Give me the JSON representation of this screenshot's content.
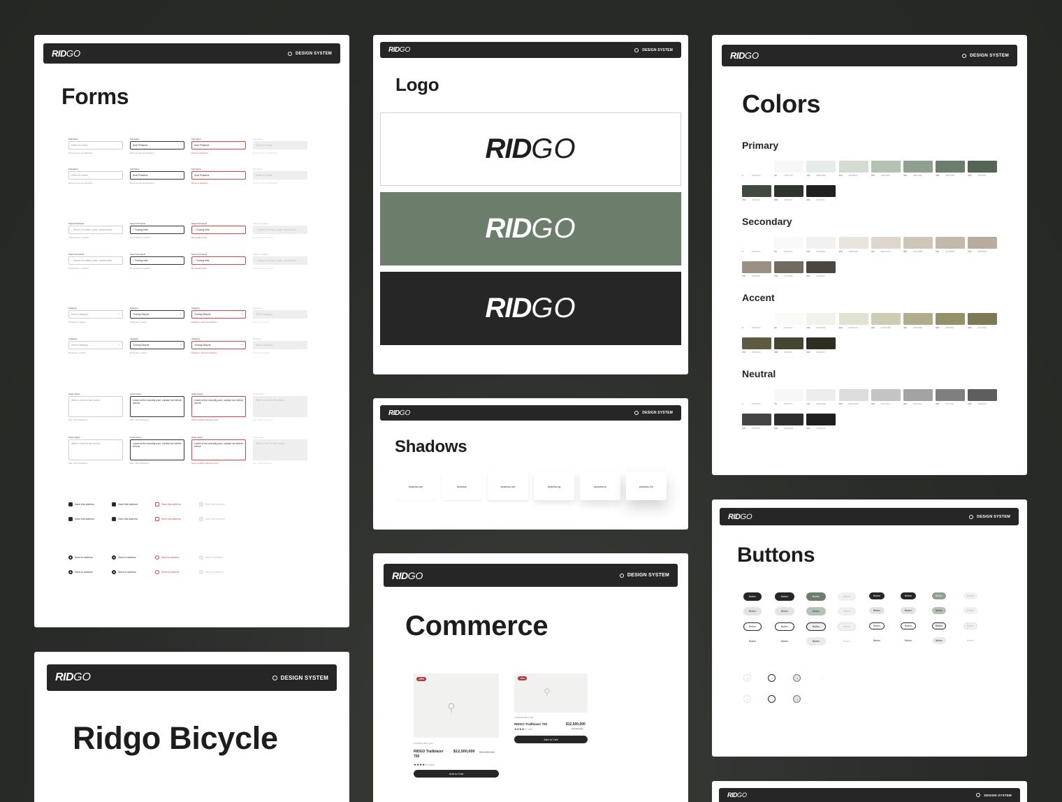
{
  "brand": {
    "logo_main": "RID",
    "logo_go": "GO",
    "header_tag": "DESIGN SYSTEM"
  },
  "forms": {
    "title": "Forms",
    "text_row1": [
      {
        "label": "Full Name",
        "value": "Enter full name",
        "hint": "Name as per identification"
      },
      {
        "label": "Full Name",
        "value": "Andi Pratama",
        "hint": "Name as per identification"
      },
      {
        "label": "Full Name",
        "value": "Andi Pratama",
        "hint": "Name is required"
      },
      {
        "label": "Full Name",
        "value": "Enter full name",
        "hint": "Name as per identification"
      }
    ],
    "text_row2": [
      {
        "label": "Full Name",
        "value": "Enter full name",
        "hint": "Name as per identification"
      },
      {
        "label": "Full Name",
        "value": "Andi Pratama",
        "hint": "Name as per identification"
      },
      {
        "label": "Full Name",
        "value": "Andi Pratama",
        "hint": "Name is required"
      },
      {
        "label": "Full Name",
        "value": "Enter full name",
        "hint": "Name as per identification"
      }
    ],
    "search_row1": [
      {
        "label": "Search Products",
        "value": "Search for bikes, parts, accessories",
        "hint": "Press Enter to search"
      },
      {
        "label": "Search Products",
        "value": "Touring bike",
        "hint": "Press Enter to search"
      },
      {
        "label": "Search Products",
        "value": "Touring bike",
        "hint": "No results found"
      },
      {
        "label": "Search Products",
        "value": "Search for bikes, parts, accessories",
        "hint": "Press Enter to search"
      }
    ],
    "search_row2": [
      {
        "label": "Search Products",
        "value": "Search for bikes, parts, accessories",
        "hint": "Press Enter to search"
      },
      {
        "label": "Search Products",
        "value": "Touring bike",
        "hint": "Press Enter to search"
      },
      {
        "label": "Search Products",
        "value": "Touring bike",
        "hint": "No results found"
      },
      {
        "label": "Search Products",
        "value": "Search for bikes, parts, accessories",
        "hint": "Press Enter to search"
      }
    ],
    "select_row1": [
      {
        "label": "Category",
        "value": "Select category",
        "hint": "Required to select"
      },
      {
        "label": "Category",
        "value": "Touring Bicycle",
        "hint": "Required to select"
      },
      {
        "label": "Category",
        "value": "Touring Bicycle",
        "hint": "Category must be selected"
      },
      {
        "label": "Category",
        "value": "Select category",
        "hint": "Required to select"
      }
    ],
    "select_row2": [
      {
        "label": "Category",
        "value": "Select category",
        "hint": "Required to select"
      },
      {
        "label": "Category",
        "value": "Touring Bicycle",
        "hint": "Required to select"
      },
      {
        "label": "Category",
        "value": "Touring Bicycle",
        "hint": "Category must be selected"
      },
      {
        "label": "Category",
        "value": "Select category",
        "hint": "Required to select"
      }
    ],
    "ta_row1": [
      {
        "label": "Order Notes",
        "value": "Write a note for the courier...",
        "hint": "Max. 200 characters"
      },
      {
        "label": "Order Notes",
        "value": "Leave at the security post, contact me before arrival.",
        "hint": "Max. 200 characters"
      },
      {
        "label": "Order Notes",
        "value": "Leave at the security post, contact me before arrival.",
        "hint": "Note exceeds maximum limit"
      },
      {
        "label": "Order Notes",
        "value": "Write a note for the courier...",
        "hint": "Max. 200 characters"
      }
    ],
    "ta_row2": [
      {
        "label": "Order Notes",
        "value": "Write a note for the courier...",
        "hint": "Max. 200 characters"
      },
      {
        "label": "Order Notes",
        "value": "Leave at the security post, contact me before arrival.",
        "hint": "Max. 200 characters"
      },
      {
        "label": "Order Notes",
        "value": "Leave at the security post, contact me before arrival.",
        "hint": "Note exceeds maximum limit"
      },
      {
        "label": "Order Notes",
        "value": "Write a note for the courier...",
        "hint": "Max. 200 characters"
      }
    ],
    "checkbox_label": "Save this address",
    "radio_label": "Send to address"
  },
  "logo_section": {
    "title": "Logo"
  },
  "shadows": {
    "title": "Shadows",
    "items": [
      "shadow-sm",
      "shadow",
      "shadow-md",
      "shadow-lg",
      "shadow-xl",
      "shadow-2xl"
    ]
  },
  "commerce": {
    "title": "Commerce",
    "card1": {
      "badge": "-20%",
      "category": "TOURING BICYCLE",
      "name": "RIDGO Trailblazer 700",
      "price": "$12,500,000",
      "old_price": "$14,500,000",
      "rating": "(120)",
      "cta": "Add to Cart"
    },
    "card2": {
      "badge": "-20%",
      "category": "TOURING BICYCLE",
      "name": "RIDGO Trailblazer 700",
      "price": "$12,500,000",
      "old_price": "$14,500,000",
      "rating": "(120)",
      "cta": "Add to Cart"
    }
  },
  "colors": {
    "title": "Colors",
    "groups": [
      {
        "name": "Primary",
        "swatches": [
          {
            "step": "0",
            "hex": "#FFFFFF"
          },
          {
            "step": "50",
            "hex": "#F6F7F6"
          },
          {
            "step": "100",
            "hex": "#E8ECE8"
          },
          {
            "step": "200",
            "hex": "#D3DBD3"
          },
          {
            "step": "300",
            "hex": "#B4C2B4"
          },
          {
            "step": "400",
            "hex": "#8EA18E"
          },
          {
            "step": "500",
            "hex": "#6B7D6B"
          },
          {
            "step": "600",
            "hex": "#546554"
          },
          {
            "step": "700",
            "hex": "#414A41"
          },
          {
            "step": "800",
            "hex": "#2E332E"
          },
          {
            "step": "900",
            "hex": "#1E211E"
          }
        ]
      },
      {
        "name": "Secondary",
        "swatches": [
          {
            "step": "0",
            "hex": "#FFFFFF"
          },
          {
            "step": "50",
            "hex": "#FAF9F7"
          },
          {
            "step": "100",
            "hex": "#F3F1ED"
          },
          {
            "step": "200",
            "hex": "#E9E5DE"
          },
          {
            "step": "300",
            "hex": "#DCD6CC"
          },
          {
            "step": "400",
            "hex": "#CEC6B9"
          },
          {
            "step": "500",
            "hex": "#C2B9AB"
          },
          {
            "step": "600",
            "hex": "#B8AD9D"
          },
          {
            "step": "700",
            "hex": "#9A9083"
          },
          {
            "step": "800",
            "hex": "#716A60"
          },
          {
            "step": "900",
            "hex": "#4A4640"
          }
        ]
      },
      {
        "name": "Accent",
        "swatches": [
          {
            "step": "0",
            "hex": "#FFFFFF"
          },
          {
            "step": "50",
            "hex": "#FAFAF7"
          },
          {
            "step": "100",
            "hex": "#F2F2EB"
          },
          {
            "step": "200",
            "hex": "#E2E2D3"
          },
          {
            "step": "300",
            "hex": "#CDCCB5"
          },
          {
            "step": "400",
            "hex": "#AFAD8C"
          },
          {
            "step": "500",
            "hex": "#939169"
          },
          {
            "step": "600",
            "hex": "#7C7A55"
          },
          {
            "step": "700",
            "hex": "#5E5C40"
          },
          {
            "step": "800",
            "hex": "#46452F"
          },
          {
            "step": "900",
            "hex": "#2E2D1F"
          }
        ]
      },
      {
        "name": "Neutral",
        "swatches": [
          {
            "step": "0",
            "hex": "#FFFFFF"
          },
          {
            "step": "50",
            "hex": "#F7F7F7"
          },
          {
            "step": "100",
            "hex": "#EDEDED"
          },
          {
            "step": "200",
            "hex": "#DCDCDC"
          },
          {
            "step": "300",
            "hex": "#C4C4C4"
          },
          {
            "step": "400",
            "hex": "#A3A3A3"
          },
          {
            "step": "500",
            "hex": "#7F7F7F"
          },
          {
            "step": "600",
            "hex": "#5E5E5E"
          },
          {
            "step": "700",
            "hex": "#454545"
          },
          {
            "step": "800",
            "hex": "#2E2E2E"
          },
          {
            "step": "900",
            "hex": "#1E1E1E"
          }
        ]
      }
    ]
  },
  "buttons": {
    "title": "Buttons",
    "label": "Button"
  },
  "ridgo_cover": {
    "title": "Ridgo Bicycle"
  }
}
